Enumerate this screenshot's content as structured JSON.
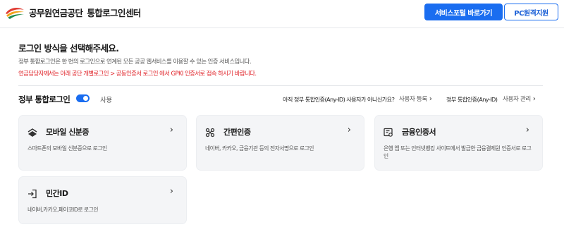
{
  "header": {
    "org_name": "공무원연금공단",
    "center_name": "통합로그인센터",
    "portal_button": "서비스포털 바로가기",
    "pc_button": "PC원격지원"
  },
  "intro": {
    "title": "로그인 방식을 선택해주세요.",
    "description": "정부 통합로그인은 한 번의 로그인으로 연계된 모든 공공 웹서비스를 이용할 수 있는 인증 서비스입니다.",
    "notice": "연금담당자께서는 아래 공단 개별로그인 > 공동인증서 로그인 에서 GPKI 인증서로 접속 하시기 바랍니다."
  },
  "integrated_login": {
    "title": "정부 통합로그인",
    "toggle_label": "사용",
    "toggle_on": true,
    "anyid_question": "아직 정부 통합인증(Any-ID) 사용자가 아니신가요?",
    "register_link": "사용자 등록",
    "anyid_label": "정부 통합인증(Any-ID)",
    "manage_link": "사용자 관리"
  },
  "cards": [
    {
      "title": "모바일 신분증",
      "icon": "mobile-id-card-icon",
      "description": "스마트폰의 모바일 신분증으로 로그인"
    },
    {
      "title": "간편인증",
      "icon": "simple-auth-icon",
      "description": "네이버, 카카오, 금융기관 등의 전자서명으로 로그인"
    },
    {
      "title": "금융인증서",
      "icon": "financial-certificate-icon",
      "description": "은행 앱 또는 인터넷뱅킹 사이트에서 발급한 금융결제원 인증서로 로그인"
    },
    {
      "title": "민간ID",
      "icon": "login-arrow-icon",
      "description": "네이버,카카오,페이코ID로 로그인"
    }
  ],
  "colors": {
    "primary": "#1a6df0",
    "notice": "#e0242a",
    "card_bg": "#f4f5f7"
  }
}
